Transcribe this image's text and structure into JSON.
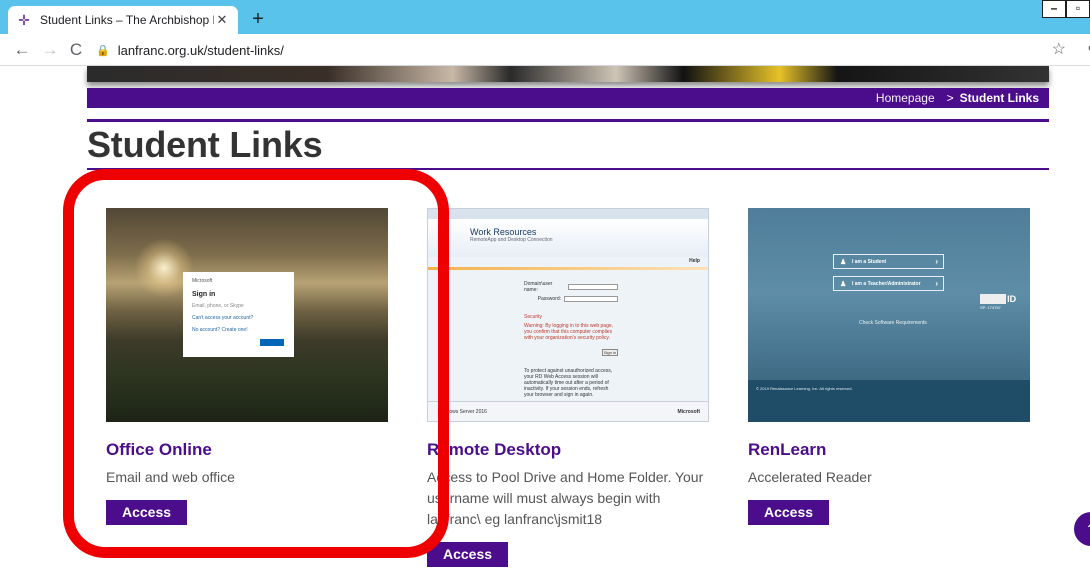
{
  "browser": {
    "tab_title": "Student Links – The Archbishop L",
    "url": "lanfranc.org.uk/student-links/",
    "favicon": "cross-icon"
  },
  "breadcrumb": {
    "home": "Homepage",
    "separator": ">",
    "current": "Student Links"
  },
  "page": {
    "title": "Student Links"
  },
  "cards": [
    {
      "name": "Office Online",
      "description": "Email and web office",
      "button": "Access"
    },
    {
      "name": "Remote Desktop",
      "description": "Access to Pool Drive and Home Folder. Your username will must always begin with lanfranc\\ eg lanfranc\\jsmit18",
      "button": "Access"
    },
    {
      "name": "RenLearn",
      "description": "Accelerated Reader",
      "button": "Access"
    }
  ],
  "thumbs": {
    "office": {
      "brand": "Microsoft",
      "heading": "Sign in",
      "line1": "Email, phone, or Skype",
      "line2": "Can't access your account?",
      "line3": "No account? Create one!"
    },
    "remote": {
      "title": "Work Resources",
      "subtitle": "RemoteApp and Desktop Connection",
      "help": "Help",
      "domain_label": "Domain\\user name:",
      "password_label": "Password:",
      "security": "Security",
      "warning": "Warning: By logging in to this web page, you confirm that this computer complies with your organization's security policy.",
      "sign_in": "Sign in",
      "note": "To protect against unauthorized access, your RD Web Access session will automatically time out after a period of inactivity. If your session ends, refresh your browser and sign in again.",
      "footer": "Windows Server 2016",
      "footer_brand": "Microsoft"
    },
    "ren": {
      "student": "I am a Student",
      "teacher": "I am a Teacher/Administrator",
      "check": "Check Software Requirements",
      "logo_id": "ID",
      "site": "SP: 174767",
      "copyright": "© 2019 Renaissance Learning, Inc. All rights reserved."
    }
  },
  "colors": {
    "brand_purple": "#4b0d8c",
    "annotation_red": "#ee0000",
    "chrome_blue": "#5ac3ec"
  }
}
